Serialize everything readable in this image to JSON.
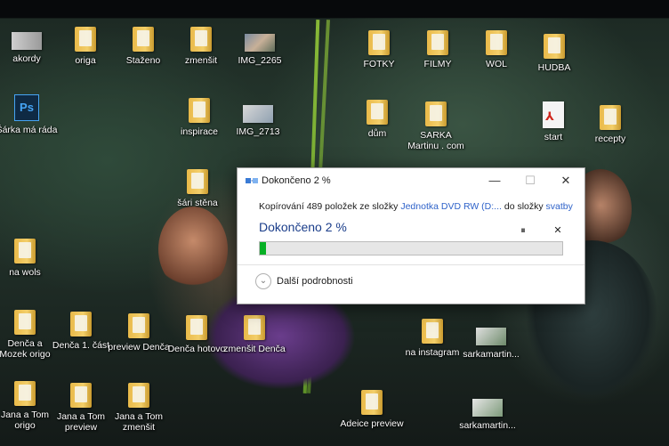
{
  "desktop": {
    "icons": [
      {
        "label": "akordy",
        "kind": "thumb"
      },
      {
        "label": "origa",
        "kind": "folder"
      },
      {
        "label": "Staženo",
        "kind": "folder"
      },
      {
        "label": "zmenšit",
        "kind": "folder"
      },
      {
        "label": "IMG_2265",
        "kind": "thumb"
      },
      {
        "label": "FOTKY",
        "kind": "folder"
      },
      {
        "label": "FILMY",
        "kind": "folder"
      },
      {
        "label": "WOL",
        "kind": "folder"
      },
      {
        "label": "HUDBA",
        "kind": "folder"
      },
      {
        "label": "Šárka má ráda",
        "kind": "psd"
      },
      {
        "label": "inspirace",
        "kind": "folder"
      },
      {
        "label": "IMG_2713",
        "kind": "thumb"
      },
      {
        "label": "dům",
        "kind": "folder"
      },
      {
        "label": "SARKA Martinu . com",
        "kind": "folder"
      },
      {
        "label": "start",
        "kind": "pdf"
      },
      {
        "label": "recepty",
        "kind": "folder"
      },
      {
        "label": "šári stěna",
        "kind": "folder"
      },
      {
        "label": "na wols",
        "kind": "folder"
      },
      {
        "label": "Denča a Mozek origo",
        "kind": "folder"
      },
      {
        "label": "Denča 1. část",
        "kind": "folder"
      },
      {
        "label": "preview Denča",
        "kind": "folder"
      },
      {
        "label": "Denča hotovo",
        "kind": "folder"
      },
      {
        "label": "zmenšit Denča",
        "kind": "folder"
      },
      {
        "label": "na instagram",
        "kind": "folder"
      },
      {
        "label": "sarkamartin...",
        "kind": "thumb"
      },
      {
        "label": "Jana a Tom origo",
        "kind": "folder"
      },
      {
        "label": "Jana a Tom preview",
        "kind": "folder"
      },
      {
        "label": "Jana a Tom zmenšit",
        "kind": "folder"
      },
      {
        "label": "Adeice preview",
        "kind": "folder"
      },
      {
        "label": "sarkamartin...",
        "kind": "thumb"
      }
    ]
  },
  "copy_dialog": {
    "title": "Dokončeno 2 %",
    "minimize_glyph": "—",
    "maximize_glyph": "☐",
    "close_glyph": "✕",
    "description_prefix": "Kopírování 489 položek ze složky ",
    "source": "Jednotka DVD RW (D:...",
    "description_mid": " do složky ",
    "destination": "svatby",
    "status": "Dokončeno 2 %",
    "progress_percent": 2,
    "progress_color": "#06b025",
    "pause_glyph": "⏸",
    "cancel_glyph": "✕",
    "details_icon": "chevron-down-icon",
    "details_glyph": "⌄",
    "details_label": "Další podrobnosti"
  }
}
